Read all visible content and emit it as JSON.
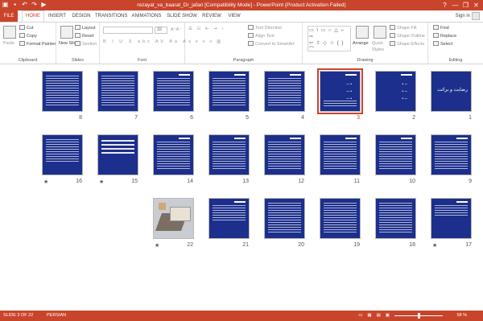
{
  "titlebar": {
    "title": "rezayat_va_baarat_Dr_jafari [Compatibility Mode] - PowerPoint (Product Activation Failed)",
    "help": "?",
    "minimize": "—",
    "restore": "❐",
    "close": "✕"
  },
  "tabs": [
    "FILE",
    "HOME",
    "INSERT",
    "DESIGN",
    "TRANSITIONS",
    "ANIMATIONS",
    "SLIDE SHOW",
    "REVIEW",
    "VIEW"
  ],
  "signin": "Sign in",
  "ribbon": {
    "clipboard": {
      "label": "Clipboard",
      "paste": "Paste",
      "cut": "Cut",
      "copy": "Copy",
      "format_painter": "Format Painter"
    },
    "slides": {
      "label": "Slides",
      "new_slide": "New Slide",
      "layout": "Layout",
      "reset": "Reset",
      "section": "Section"
    },
    "font": {
      "label": "Font",
      "size": "32"
    },
    "paragraph": {
      "label": "Paragraph",
      "text_direction": "Text Direction",
      "align_text": "Align Text",
      "convert": "Convert to SmartArt"
    },
    "drawing": {
      "label": "Drawing",
      "arrange": "Arrange",
      "quick_styles": "Quick Styles",
      "shape_fill": "Shape Fill",
      "shape_outline": "Shape Outline",
      "shape_effects": "Shape Effects"
    },
    "editing": {
      "label": "Editing",
      "find": "Find",
      "replace": "Replace",
      "select": "Select"
    }
  },
  "slides": [
    {
      "num": "1",
      "kind": "title",
      "title": "رضایت و برائت"
    },
    {
      "num": "2",
      "kind": "bullets"
    },
    {
      "num": "3",
      "kind": "bullets",
      "selected": true
    },
    {
      "num": "4",
      "kind": "text"
    },
    {
      "num": "5",
      "kind": "text"
    },
    {
      "num": "6",
      "kind": "text"
    },
    {
      "num": "7",
      "kind": "text"
    },
    {
      "num": "8",
      "kind": "text"
    },
    {
      "num": "9",
      "kind": "text"
    },
    {
      "num": "10",
      "kind": "text"
    },
    {
      "num": "11",
      "kind": "text"
    },
    {
      "num": "12",
      "kind": "text"
    },
    {
      "num": "13",
      "kind": "text"
    },
    {
      "num": "14",
      "kind": "text"
    },
    {
      "num": "15",
      "kind": "big",
      "star": true
    },
    {
      "num": "16",
      "kind": "text",
      "star": true
    },
    {
      "num": "17",
      "kind": "text",
      "star": true
    },
    {
      "num": "18",
      "kind": "text"
    },
    {
      "num": "19",
      "kind": "text"
    },
    {
      "num": "20",
      "kind": "text"
    },
    {
      "num": "21",
      "kind": "text"
    },
    {
      "num": "22",
      "kind": "photo",
      "star": true
    }
  ],
  "status": {
    "slide": "SLIDE 3 OF 22",
    "language": "PERSIAN",
    "zoom": "58 %"
  },
  "colors": {
    "accent": "#c8452b",
    "slide_bg": "#1c2f8c"
  }
}
